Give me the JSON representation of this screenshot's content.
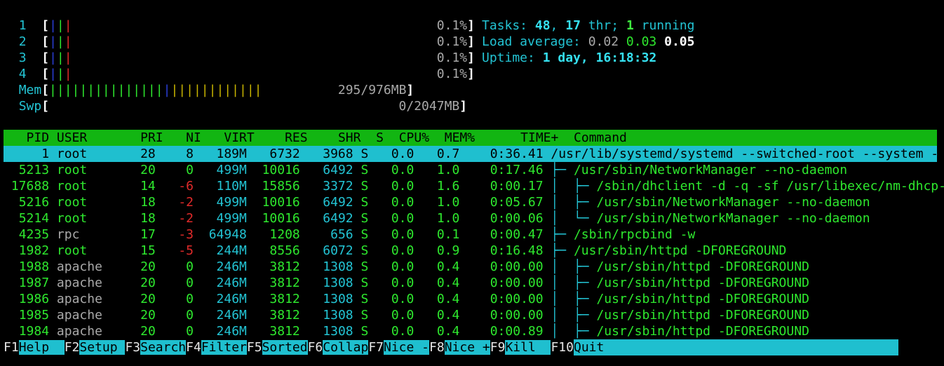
{
  "meters": {
    "cpus": [
      {
        "label": "1",
        "percent": "0.1%"
      },
      {
        "label": "2",
        "percent": "0.1%"
      },
      {
        "label": "3",
        "percent": "0.1%"
      },
      {
        "label": "4",
        "percent": "0.1%"
      }
    ],
    "mem": {
      "label": "Mem",
      "value": "295/976MB"
    },
    "swp": {
      "label": "Swp",
      "value": "0/2047MB"
    }
  },
  "summary": {
    "tasks_label": "Tasks: ",
    "tasks_count": "48",
    "thr_count": "17",
    "thr_label": " thr; ",
    "running_count": "1",
    "running_label": " running",
    "load_label": "Load average: ",
    "load_1": "0.02",
    "load_5": "0.03",
    "load_15": "0.05",
    "uptime_label": "Uptime: ",
    "uptime_value": "1 day, 16:18:32"
  },
  "header": {
    "pid": "PID",
    "user": "USER",
    "pri": "PRI",
    "ni": "NI",
    "virt": "VIRT",
    "res": "RES",
    "shr": "SHR",
    "s": "S",
    "cpu": "CPU%",
    "mem": "MEM%",
    "time": "TIME+",
    "command": "Command"
  },
  "processes": [
    {
      "pid": "1",
      "user": "root",
      "pri": "28",
      "ni": "8",
      "virt": "189M",
      "res": "6732",
      "shr": "3968",
      "s": "S",
      "cpu": "0.0",
      "mem": "0.7",
      "time": "0:36.41",
      "tree": "",
      "cmd": "/usr/lib/systemd/systemd --switched-root --system --dese"
    },
    {
      "pid": "5213",
      "user": "root",
      "pri": "20",
      "ni": "0",
      "virt": "499M",
      "res": "10016",
      "shr": "6492",
      "s": "S",
      "cpu": "0.0",
      "mem": "1.0",
      "time": "0:17.46",
      "tree": "├─ ",
      "cmd": "/usr/sbin/NetworkManager --no-daemon"
    },
    {
      "pid": "17688",
      "user": "root",
      "pri": "14",
      "ni": "-6",
      "virt": "110M",
      "res": "15856",
      "shr": "3372",
      "s": "S",
      "cpu": "0.0",
      "mem": "1.6",
      "time": "0:00.17",
      "tree": "│  ├─ ",
      "cmd": "/sbin/dhclient -d -q -sf /usr/libexec/nm-dhcp-help"
    },
    {
      "pid": "5216",
      "user": "root",
      "pri": "18",
      "ni": "-2",
      "virt": "499M",
      "res": "10016",
      "shr": "6492",
      "s": "S",
      "cpu": "0.0",
      "mem": "1.0",
      "time": "0:05.67",
      "tree": "│  ├─ ",
      "cmd": "/usr/sbin/NetworkManager --no-daemon"
    },
    {
      "pid": "5214",
      "user": "root",
      "pri": "18",
      "ni": "-2",
      "virt": "499M",
      "res": "10016",
      "shr": "6492",
      "s": "S",
      "cpu": "0.0",
      "mem": "1.0",
      "time": "0:00.06",
      "tree": "│  └─ ",
      "cmd": "/usr/sbin/NetworkManager --no-daemon"
    },
    {
      "pid": "4235",
      "user": "rpc",
      "pri": "17",
      "ni": "-3",
      "virt": "64948",
      "res": "1208",
      "shr": "656",
      "s": "S",
      "cpu": "0.0",
      "mem": "0.1",
      "time": "0:00.47",
      "tree": "├─ ",
      "cmd": "/sbin/rpcbind -w"
    },
    {
      "pid": "1982",
      "user": "root",
      "pri": "15",
      "ni": "-5",
      "virt": "244M",
      "res": "8556",
      "shr": "6072",
      "s": "S",
      "cpu": "0.0",
      "mem": "0.9",
      "time": "0:16.48",
      "tree": "├─ ",
      "cmd": "/usr/sbin/httpd -DFOREGROUND"
    },
    {
      "pid": "1988",
      "user": "apache",
      "pri": "20",
      "ni": "0",
      "virt": "246M",
      "res": "3812",
      "shr": "1308",
      "s": "S",
      "cpu": "0.0",
      "mem": "0.4",
      "time": "0:00.00",
      "tree": "│  ├─ ",
      "cmd": "/usr/sbin/httpd -DFOREGROUND"
    },
    {
      "pid": "1987",
      "user": "apache",
      "pri": "20",
      "ni": "0",
      "virt": "246M",
      "res": "3812",
      "shr": "1308",
      "s": "S",
      "cpu": "0.0",
      "mem": "0.4",
      "time": "0:00.00",
      "tree": "│  ├─ ",
      "cmd": "/usr/sbin/httpd -DFOREGROUND"
    },
    {
      "pid": "1986",
      "user": "apache",
      "pri": "20",
      "ni": "0",
      "virt": "246M",
      "res": "3812",
      "shr": "1308",
      "s": "S",
      "cpu": "0.0",
      "mem": "0.4",
      "time": "0:00.00",
      "tree": "│  ├─ ",
      "cmd": "/usr/sbin/httpd -DFOREGROUND"
    },
    {
      "pid": "1985",
      "user": "apache",
      "pri": "20",
      "ni": "0",
      "virt": "246M",
      "res": "3812",
      "shr": "1308",
      "s": "S",
      "cpu": "0.0",
      "mem": "0.4",
      "time": "0:00.00",
      "tree": "│  ├─ ",
      "cmd": "/usr/sbin/httpd -DFOREGROUND"
    },
    {
      "pid": "1984",
      "user": "apache",
      "pri": "20",
      "ni": "0",
      "virt": "246M",
      "res": "3812",
      "shr": "1308",
      "s": "S",
      "cpu": "0.0",
      "mem": "0.4",
      "time": "0:00.89",
      "tree": "│  ├─ ",
      "cmd": "/usr/sbin/httpd -DFOREGROUND"
    }
  ],
  "fkeys": [
    {
      "key": "F1",
      "label": "Help  "
    },
    {
      "key": "F2",
      "label": "Setup "
    },
    {
      "key": "F3",
      "label": "Search"
    },
    {
      "key": "F4",
      "label": "Filter"
    },
    {
      "key": "F5",
      "label": "Sorted"
    },
    {
      "key": "F6",
      "label": "Collap"
    },
    {
      "key": "F7",
      "label": "Nice -"
    },
    {
      "key": "F8",
      "label": "Nice +"
    },
    {
      "key": "F9",
      "label": "Kill  "
    },
    {
      "key": "F10",
      "label": "Quit"
    }
  ]
}
